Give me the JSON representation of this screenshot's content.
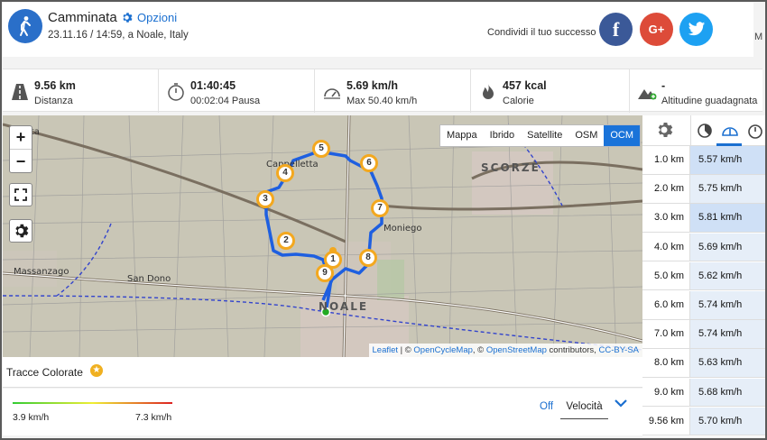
{
  "header": {
    "title": "Camminata",
    "options_label": "Opzioni",
    "subtitle": "23.11.16 / 14:59, a Noale, Italy",
    "share_text": "Condividi il tuo successo",
    "facebook": "f",
    "google_plus": "G+",
    "right_cut": "M"
  },
  "stats": [
    {
      "icon": "road-icon",
      "value": "9.56 km",
      "label": "Distanza"
    },
    {
      "icon": "stopwatch-icon",
      "value": "01:40:45",
      "label": "00:02:04 Pausa"
    },
    {
      "icon": "speedometer-icon",
      "value": "5.69 km/h",
      "label": "Max 50.40 km/h"
    },
    {
      "icon": "flame-icon",
      "value": "457 kcal",
      "label": "Calorie"
    },
    {
      "icon": "mountain-icon",
      "value": "-",
      "label": "Altitudine guadagnata"
    }
  ],
  "map": {
    "layers": [
      "Mappa",
      "Ibrido",
      "Satellite",
      "OSM",
      "OCM"
    ],
    "active_layer": "OCM",
    "zoom_in": "+",
    "zoom_out": "−",
    "place_labels": [
      "Scorzè",
      "Noale",
      "Cappelletta",
      "Moniego",
      "Massanzago",
      "San Dono",
      "Piazza"
    ],
    "markers": [
      "1",
      "2",
      "3",
      "4",
      "5",
      "6",
      "7",
      "8",
      "9"
    ],
    "attribution": {
      "leaflet": "Leaflet",
      "sep1": " | © ",
      "ocm": "OpenCycleMap",
      "sep2": ", © ",
      "osm": "OpenStreetMap",
      "contrib": " contributors, ",
      "license": "CC-BY-SA"
    }
  },
  "tracce": {
    "title": "Tracce Colorate"
  },
  "legend": {
    "min": "3.9 km/h",
    "max": "7.3 km/h",
    "off_label": "Off",
    "select_value": "Velocità",
    "color_low": "#33cc33",
    "color_mid": "#eeee33",
    "color_high": "#dd2222"
  },
  "splits": [
    {
      "km": "1.0 km",
      "speed": "5.57 km/h"
    },
    {
      "km": "2.0 km",
      "speed": "5.75 km/h"
    },
    {
      "km": "3.0 km",
      "speed": "5.81 km/h"
    },
    {
      "km": "4.0 km",
      "speed": "5.69 km/h"
    },
    {
      "km": "5.0 km",
      "speed": "5.62 km/h"
    },
    {
      "km": "6.0 km",
      "speed": "5.74 km/h"
    },
    {
      "km": "7.0 km",
      "speed": "5.74 km/h"
    },
    {
      "km": "8.0 km",
      "speed": "5.63 km/h"
    },
    {
      "km": "9.0 km",
      "speed": "5.68 km/h"
    },
    {
      "km": "9.56 km",
      "speed": "5.70 km/h"
    }
  ],
  "colors": {
    "accent": "#1a6fd0",
    "track": "#1e5fe0",
    "marker": "#f3a81f"
  }
}
